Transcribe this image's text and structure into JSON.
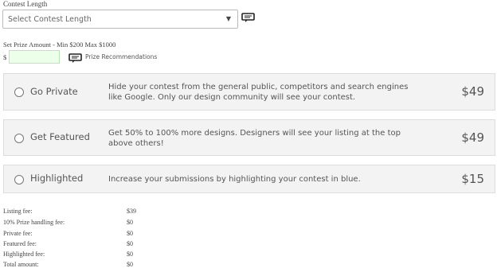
{
  "contest_length": {
    "label": "Contest Length",
    "selected": "Select Contest Length"
  },
  "prize": {
    "label": "Set Prize Amount - Min $200 Max $1000",
    "currency": "$",
    "value": "",
    "recommendations_label": "Prize Recommendations"
  },
  "options": [
    {
      "title": "Go Private",
      "description": "Hide your contest from the general public, competitors and search engines like Google. Only our design community will see your contest.",
      "price": "$49"
    },
    {
      "title": "Get Featured",
      "description": "Get 50% to 100% more designs. Designers will see your listing at the top above others!",
      "price": "$49"
    },
    {
      "title": "Highlighted",
      "description": "Increase your submissions by highlighting your contest in blue.",
      "price": "$15"
    }
  ],
  "fees": [
    {
      "label": "Listing fee:",
      "value": "$39"
    },
    {
      "label": "10% Prize handling fee:",
      "value": "$0"
    },
    {
      "label": "Private fee:",
      "value": "$0"
    },
    {
      "label": "Featured fee:",
      "value": "$0"
    },
    {
      "label": "Highlighted fee:",
      "value": "$0"
    },
    {
      "label": "Total amount:",
      "value": "$0"
    }
  ],
  "icons": {
    "chat": "chat-bubble-icon",
    "dropdown": "chevron-down-icon",
    "radio": "radio-unchecked-icon"
  }
}
